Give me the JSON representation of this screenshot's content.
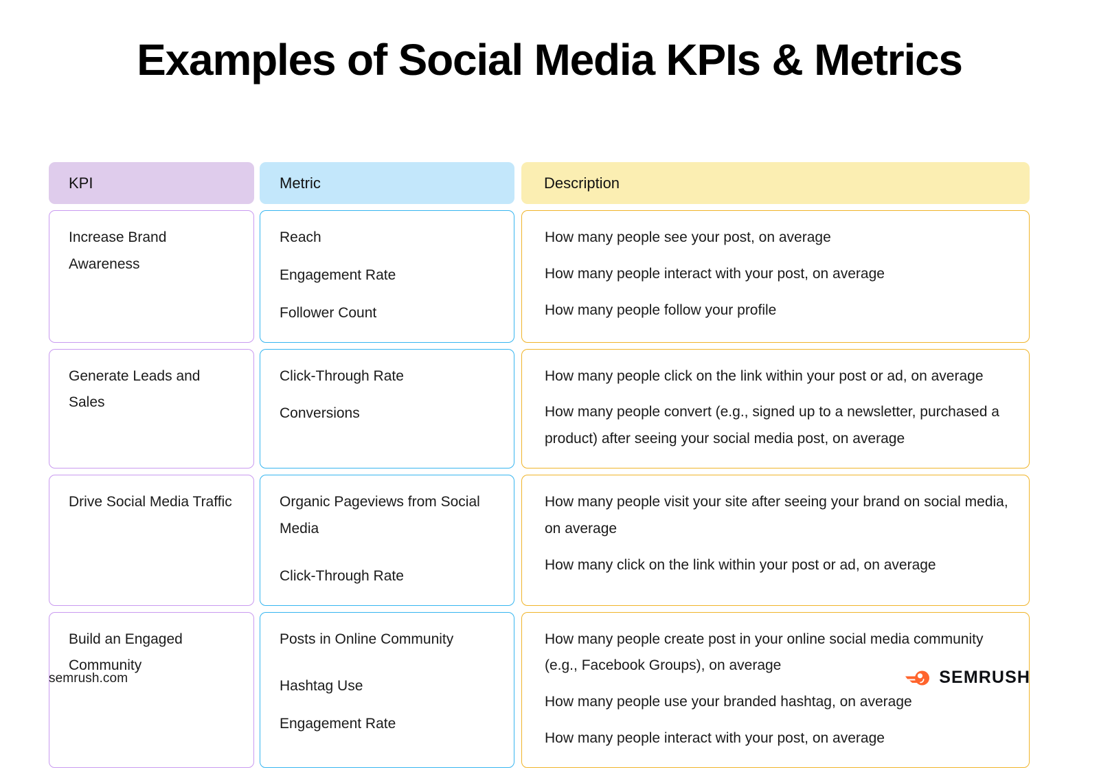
{
  "page": {
    "title": "Examples of Social Media KPIs & Metrics",
    "background": "#ffffff"
  },
  "table": {
    "headers": {
      "kpi": "KPI",
      "metric": "Metric",
      "description": "Description"
    },
    "header_colors": {
      "kpi": "#dfccec",
      "metric": "#c3e7fb",
      "description": "#fbeeb2"
    },
    "cell_border_colors": {
      "kpi": "#c99af0",
      "metric": "#36b5f0",
      "description": "#f0b429"
    },
    "rows": [
      {
        "kpi": "Increase Brand Awareness",
        "metrics": [
          "Reach",
          "Engagement Rate",
          "Follower Count"
        ],
        "descriptions": [
          "How many people see your post, on average",
          "How many people interact with your post, on average",
          "How many people follow your profile"
        ]
      },
      {
        "kpi": "Generate Leads and Sales",
        "metrics": [
          "Click-Through Rate",
          "Conversions"
        ],
        "descriptions": [
          "How many people click on the link within your post or ad, on average",
          "How many people convert (e.g., signed up to a newsletter, purchased a product) after seeing your social media post, on average"
        ]
      },
      {
        "kpi": "Drive Social Media Traffic",
        "metrics": [
          "Organic Pageviews from Social Media",
          "Click-Through Rate"
        ],
        "descriptions": [
          "How many people visit your site after seeing your brand on social media, on average",
          "How many click on the link within your post or ad, on average"
        ]
      },
      {
        "kpi": "Build an Engaged Community",
        "metrics": [
          "Posts in Online Community",
          "Hashtag Use",
          "Engagement Rate"
        ],
        "descriptions": [
          "How many people create post in your online social media community (e.g., Facebook Groups), on average",
          "How many people use your branded hashtag, on average",
          "How many people interact with your post, on average"
        ]
      }
    ]
  },
  "footer": {
    "url": "semrush.com",
    "brand_name": "SEMRUSH",
    "brand_color": "#ff642d",
    "logo_icon": "semrush-comet-icon"
  }
}
